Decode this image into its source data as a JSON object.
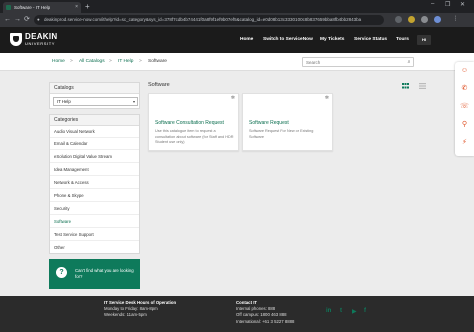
{
  "browser": {
    "tab_title": "Software - IT Help",
    "tab_close": "×",
    "new_tab": "+",
    "url": "deakinprod.service-now.com/ithelp?id=sc_category&sys_id=378f7cdb4b74441f0a8f9f1ef9b07ef5&catalog_id=e0d08b13c3330100c8b837659bba8fb4bb2843ba",
    "back": "←",
    "forward": "→",
    "reload": "⟳",
    "lock": "🔒",
    "window_controls": [
      "–",
      "❐",
      "✕"
    ]
  },
  "header": {
    "logo_line1": "DEAKIN",
    "logo_line2": "UNIVERSITY",
    "nav": [
      "Home",
      "Switch to ServiceNow",
      "My Tickets",
      "Service Status",
      "Tours"
    ],
    "user_badge": "HI"
  },
  "breadcrumbs": [
    "Home",
    "All Catalogs",
    "IT Help",
    "Software"
  ],
  "breadcrumb_sep": ">",
  "search": {
    "placeholder": "Search",
    "icon": "⌕"
  },
  "catalogs": {
    "title": "Catalogs",
    "selected": "IT Help",
    "caret": "▾"
  },
  "categories": {
    "title": "Categories",
    "items": [
      "Audio Visual Network",
      "Email & Calendar",
      "eSolution Digital Value Stream",
      "Idea Management",
      "Network & Access",
      "Phone & Skype",
      "Security",
      "Software",
      "Test Service Support",
      "Other"
    ],
    "active_index": 7
  },
  "help_box": {
    "icon": "?",
    "text": "Can't find what you are looking for?"
  },
  "main": {
    "title": "Software",
    "cards": [
      {
        "title": "Software Consultation Request",
        "description": "Use this catalogue item to request a consultation about software (for Staff and HDR Student use only)",
        "star": "✲"
      },
      {
        "title": "Software Request",
        "description": "Software Request For New or Existing Software",
        "star": "✲"
      }
    ]
  },
  "float_tools": [
    "☺",
    "✆",
    "☏",
    "⚲",
    "⚡"
  ],
  "footer": {
    "hours_title": "IT Service Desk Hours of Operation",
    "hours_lines": [
      "Monday to Friday: 8am-8pm",
      "Weekends: 11am-5pm"
    ],
    "contact_title": "Contact IT",
    "contact_lines": [
      "Internal phones: 888",
      "Off campus: 1800 463 888",
      "International: +61 3 5227 8888"
    ],
    "social": [
      "in",
      "t",
      "▶",
      "f"
    ]
  },
  "colors": {
    "brand_green": "#0e7a5b",
    "header_bg": "#1b1b1b",
    "footer_bg": "#2b2b2b",
    "accent_orange": "#e0572c"
  }
}
